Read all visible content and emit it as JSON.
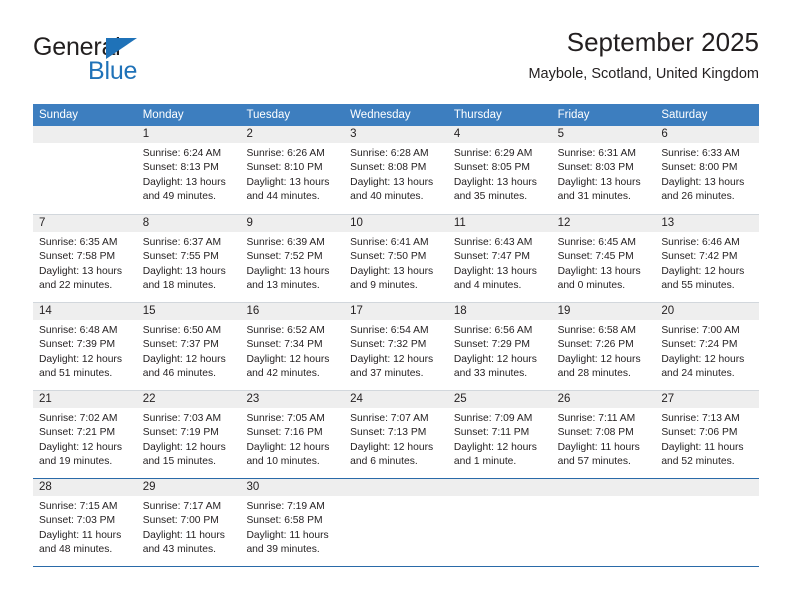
{
  "brand": {
    "name_top": "General",
    "name_bottom": "Blue",
    "triangle_icon": "triangle-logo-icon",
    "colors": {
      "blue": "#1f72b8",
      "black": "#221f1f"
    }
  },
  "header": {
    "title": "September 2025",
    "subtitle": "Maybole, Scotland, United Kingdom"
  },
  "calendar": {
    "header_bg": "#3d7ebf",
    "day_band_bg": "#eeeeee",
    "weekdays": [
      "Sunday",
      "Monday",
      "Tuesday",
      "Wednesday",
      "Thursday",
      "Friday",
      "Saturday"
    ],
    "weeks": [
      [
        {
          "day": "",
          "lines": []
        },
        {
          "day": "1",
          "lines": [
            "Sunrise: 6:24 AM",
            "Sunset: 8:13 PM",
            "Daylight: 13 hours",
            "and 49 minutes."
          ]
        },
        {
          "day": "2",
          "lines": [
            "Sunrise: 6:26 AM",
            "Sunset: 8:10 PM",
            "Daylight: 13 hours",
            "and 44 minutes."
          ]
        },
        {
          "day": "3",
          "lines": [
            "Sunrise: 6:28 AM",
            "Sunset: 8:08 PM",
            "Daylight: 13 hours",
            "and 40 minutes."
          ]
        },
        {
          "day": "4",
          "lines": [
            "Sunrise: 6:29 AM",
            "Sunset: 8:05 PM",
            "Daylight: 13 hours",
            "and 35 minutes."
          ]
        },
        {
          "day": "5",
          "lines": [
            "Sunrise: 6:31 AM",
            "Sunset: 8:03 PM",
            "Daylight: 13 hours",
            "and 31 minutes."
          ]
        },
        {
          "day": "6",
          "lines": [
            "Sunrise: 6:33 AM",
            "Sunset: 8:00 PM",
            "Daylight: 13 hours",
            "and 26 minutes."
          ]
        }
      ],
      [
        {
          "day": "7",
          "lines": [
            "Sunrise: 6:35 AM",
            "Sunset: 7:58 PM",
            "Daylight: 13 hours",
            "and 22 minutes."
          ]
        },
        {
          "day": "8",
          "lines": [
            "Sunrise: 6:37 AM",
            "Sunset: 7:55 PM",
            "Daylight: 13 hours",
            "and 18 minutes."
          ]
        },
        {
          "day": "9",
          "lines": [
            "Sunrise: 6:39 AM",
            "Sunset: 7:52 PM",
            "Daylight: 13 hours",
            "and 13 minutes."
          ]
        },
        {
          "day": "10",
          "lines": [
            "Sunrise: 6:41 AM",
            "Sunset: 7:50 PM",
            "Daylight: 13 hours",
            "and 9 minutes."
          ]
        },
        {
          "day": "11",
          "lines": [
            "Sunrise: 6:43 AM",
            "Sunset: 7:47 PM",
            "Daylight: 13 hours",
            "and 4 minutes."
          ]
        },
        {
          "day": "12",
          "lines": [
            "Sunrise: 6:45 AM",
            "Sunset: 7:45 PM",
            "Daylight: 13 hours",
            "and 0 minutes."
          ]
        },
        {
          "day": "13",
          "lines": [
            "Sunrise: 6:46 AM",
            "Sunset: 7:42 PM",
            "Daylight: 12 hours",
            "and 55 minutes."
          ]
        }
      ],
      [
        {
          "day": "14",
          "lines": [
            "Sunrise: 6:48 AM",
            "Sunset: 7:39 PM",
            "Daylight: 12 hours",
            "and 51 minutes."
          ]
        },
        {
          "day": "15",
          "lines": [
            "Sunrise: 6:50 AM",
            "Sunset: 7:37 PM",
            "Daylight: 12 hours",
            "and 46 minutes."
          ]
        },
        {
          "day": "16",
          "lines": [
            "Sunrise: 6:52 AM",
            "Sunset: 7:34 PM",
            "Daylight: 12 hours",
            "and 42 minutes."
          ]
        },
        {
          "day": "17",
          "lines": [
            "Sunrise: 6:54 AM",
            "Sunset: 7:32 PM",
            "Daylight: 12 hours",
            "and 37 minutes."
          ]
        },
        {
          "day": "18",
          "lines": [
            "Sunrise: 6:56 AM",
            "Sunset: 7:29 PM",
            "Daylight: 12 hours",
            "and 33 minutes."
          ]
        },
        {
          "day": "19",
          "lines": [
            "Sunrise: 6:58 AM",
            "Sunset: 7:26 PM",
            "Daylight: 12 hours",
            "and 28 minutes."
          ]
        },
        {
          "day": "20",
          "lines": [
            "Sunrise: 7:00 AM",
            "Sunset: 7:24 PM",
            "Daylight: 12 hours",
            "and 24 minutes."
          ]
        }
      ],
      [
        {
          "day": "21",
          "lines": [
            "Sunrise: 7:02 AM",
            "Sunset: 7:21 PM",
            "Daylight: 12 hours",
            "and 19 minutes."
          ]
        },
        {
          "day": "22",
          "lines": [
            "Sunrise: 7:03 AM",
            "Sunset: 7:19 PM",
            "Daylight: 12 hours",
            "and 15 minutes."
          ]
        },
        {
          "day": "23",
          "lines": [
            "Sunrise: 7:05 AM",
            "Sunset: 7:16 PM",
            "Daylight: 12 hours",
            "and 10 minutes."
          ]
        },
        {
          "day": "24",
          "lines": [
            "Sunrise: 7:07 AM",
            "Sunset: 7:13 PM",
            "Daylight: 12 hours",
            "and 6 minutes."
          ]
        },
        {
          "day": "25",
          "lines": [
            "Sunrise: 7:09 AM",
            "Sunset: 7:11 PM",
            "Daylight: 12 hours",
            "and 1 minute."
          ]
        },
        {
          "day": "26",
          "lines": [
            "Sunrise: 7:11 AM",
            "Sunset: 7:08 PM",
            "Daylight: 11 hours",
            "and 57 minutes."
          ]
        },
        {
          "day": "27",
          "lines": [
            "Sunrise: 7:13 AM",
            "Sunset: 7:06 PM",
            "Daylight: 11 hours",
            "and 52 minutes."
          ]
        }
      ],
      [
        {
          "day": "28",
          "lines": [
            "Sunrise: 7:15 AM",
            "Sunset: 7:03 PM",
            "Daylight: 11 hours",
            "and 48 minutes."
          ]
        },
        {
          "day": "29",
          "lines": [
            "Sunrise: 7:17 AM",
            "Sunset: 7:00 PM",
            "Daylight: 11 hours",
            "and 43 minutes."
          ]
        },
        {
          "day": "30",
          "lines": [
            "Sunrise: 7:19 AM",
            "Sunset: 6:58 PM",
            "Daylight: 11 hours",
            "and 39 minutes."
          ]
        },
        {
          "day": "",
          "lines": []
        },
        {
          "day": "",
          "lines": []
        },
        {
          "day": "",
          "lines": []
        },
        {
          "day": "",
          "lines": []
        }
      ]
    ]
  }
}
